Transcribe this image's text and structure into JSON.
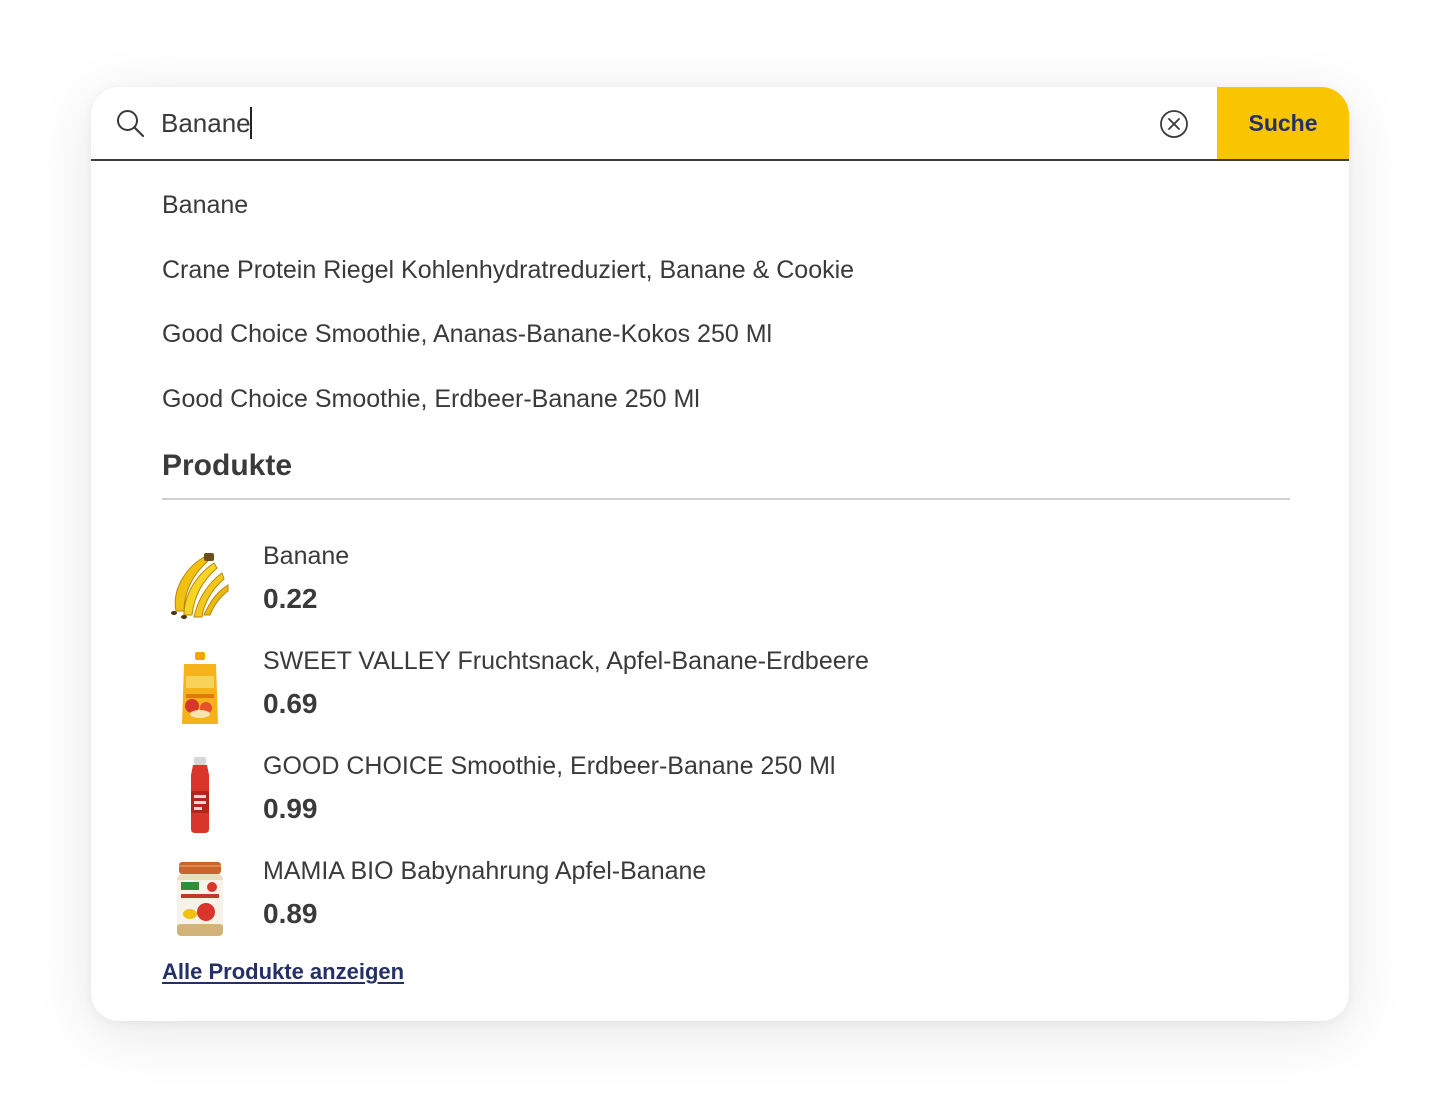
{
  "search": {
    "value": "Banane",
    "button_label": "Suche"
  },
  "suggestions": [
    {
      "label": "Banane"
    },
    {
      "label": "Crane Protein Riegel Kohlenhydratreduziert, Banane & Cookie"
    },
    {
      "label": "Good Choice Smoothie, Ananas-Banane-Kokos 250 Ml"
    },
    {
      "label": "Good Choice Smoothie, Erdbeer-Banane 250 Ml"
    }
  ],
  "products_section": {
    "title": "Produkte",
    "items": [
      {
        "name": "Banane",
        "price": "0.22",
        "image": "banana-image"
      },
      {
        "name": "SWEET VALLEY Fruchtsnack, Apfel-Banane-Erdbeere",
        "price": "0.69",
        "image": "fruit-pouch-image"
      },
      {
        "name": "GOOD CHOICE Smoothie, Erdbeer-Banane 250 Ml",
        "price": "0.99",
        "image": "smoothie-bottle-image"
      },
      {
        "name": "MAMIA BIO Babynahrung Apfel-Banane",
        "price": "0.89",
        "image": "baby-food-jar-image"
      }
    ],
    "all_link": "Alle Produkte anzeigen"
  },
  "colors": {
    "accent": "#f9c500",
    "link": "#243066",
    "text": "#3a3a3a"
  }
}
